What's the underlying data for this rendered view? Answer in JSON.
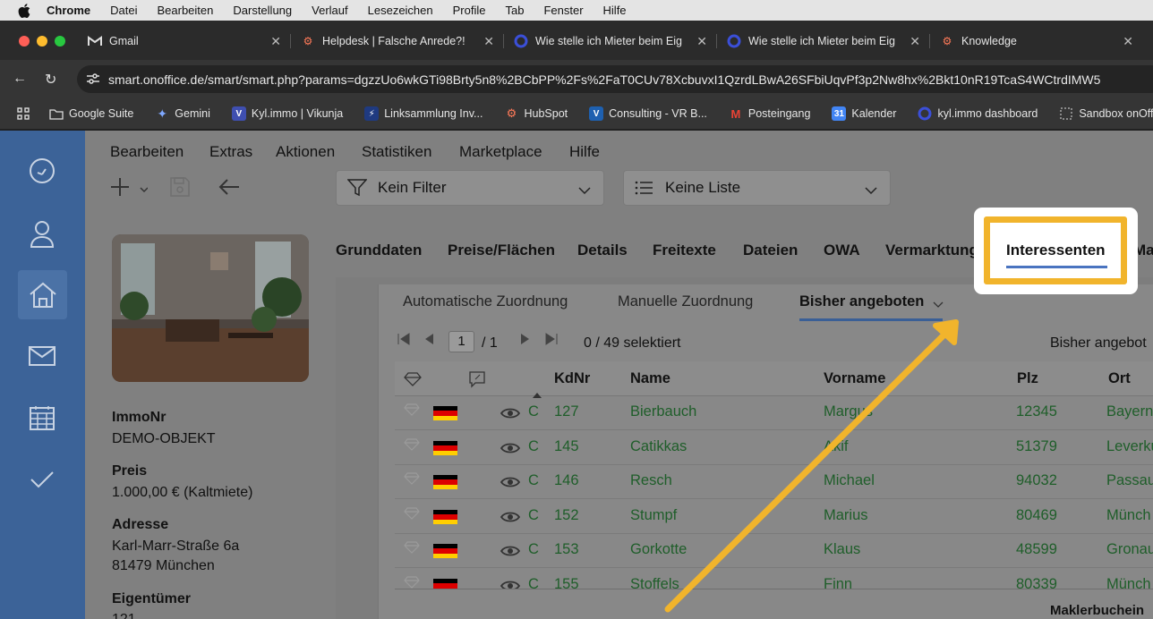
{
  "os_menu": {
    "app": "Chrome",
    "items": [
      "Datei",
      "Bearbeiten",
      "Darstellung",
      "Verlauf",
      "Lesezeichen",
      "Profile",
      "Tab",
      "Fenster",
      "Hilfe"
    ]
  },
  "tabs": [
    {
      "title": "Gmail",
      "icon": "gmail-icon"
    },
    {
      "title": "Helpdesk | Falsche Anrede?!",
      "icon": "hubspot-icon"
    },
    {
      "title": "Wie stelle ich Mieter beim Eig",
      "icon": "onoffice-icon"
    },
    {
      "title": "Wie stelle ich Mieter beim Eig",
      "icon": "onoffice-icon"
    },
    {
      "title": "Knowledge",
      "icon": "hubspot-icon"
    }
  ],
  "address": {
    "url": "smart.onoffice.de/smart/smart.php?params=dgzzUo6wkGTi98Brty5n8%2BCbPP%2Fs%2FaT0CUv78XcbuvxI1QzrdLBwA26SFbiUqvPf3p2Nw8hx%2Bkt10nR19TcaS4WCtrdIMW5"
  },
  "bookmarks": [
    {
      "label": "Google Suite",
      "icon": "folder-icon"
    },
    {
      "label": "Gemini",
      "icon": "gemini-icon"
    },
    {
      "label": "Kyl.immo | Vikunja",
      "icon": "vikunja-icon"
    },
    {
      "label": "Linksammlung Inv...",
      "icon": "link-icon"
    },
    {
      "label": "HubSpot",
      "icon": "hubspot-icon"
    },
    {
      "label": "Consulting - VR B...",
      "icon": "vr-icon"
    },
    {
      "label": "Posteingang",
      "icon": "gmail-icon"
    },
    {
      "label": "Kalender",
      "icon": "calendar-icon"
    },
    {
      "label": "kyl.immo dashboard",
      "icon": "onoffice-icon"
    },
    {
      "label": "Sandbox onOffice",
      "icon": "dashed-box-icon"
    }
  ],
  "app_menu": [
    "Bearbeiten",
    "Extras",
    "Aktionen",
    "Statistiken",
    "Marketplace",
    "Hilfe"
  ],
  "filters": {
    "filter_label": "Kein Filter",
    "list_label": "Keine Liste"
  },
  "estate": {
    "immonr_label": "ImmoNr",
    "immonr_value": "DEMO-OBJEKT",
    "preis_label": "Preis",
    "preis_value": "1.000,00 € (Kaltmiete)",
    "adresse_label": "Adresse",
    "adresse_line1": "Karl-Marr-Straße 6a",
    "adresse_line2": "81479 München",
    "eigentuemer_label": "Eigentümer",
    "eigentuemer_value": "121"
  },
  "main_tabs": [
    "Grunddaten",
    "Preise/Flächen",
    "Details",
    "Freitexte",
    "Dateien",
    "OWA",
    "Vermarktung",
    "Interessenten",
    "Ma"
  ],
  "active_main_tab": "Interessenten",
  "sub_tabs": [
    "Automatische Zuordnung",
    "Manuelle Zuordnung",
    "Bisher angeboten"
  ],
  "pager": {
    "page": "1",
    "total": "/ 1",
    "selected": "0 / 49 selektiert",
    "right_label": "Bisher angebot"
  },
  "table": {
    "headers": [
      "KdNr",
      "Name",
      "Vorname",
      "Plz",
      "Ort"
    ],
    "rows": [
      {
        "c": "C",
        "kdnr": "127",
        "name": "Bierbauch",
        "vorname": "Margus",
        "plz": "12345",
        "ort": "Bayern"
      },
      {
        "c": "C",
        "kdnr": "145",
        "name": "Catikkas",
        "vorname": "Akif",
        "plz": "51379",
        "ort": "Leverku"
      },
      {
        "c": "C",
        "kdnr": "146",
        "name": "Resch",
        "vorname": "Michael",
        "plz": "94032",
        "ort": "Passau"
      },
      {
        "c": "C",
        "kdnr": "152",
        "name": "Stumpf",
        "vorname": "Marius",
        "plz": "80469",
        "ort": "Münch"
      },
      {
        "c": "C",
        "kdnr": "153",
        "name": "Gorkotte",
        "vorname": "Klaus",
        "plz": "48599",
        "ort": "Gronau"
      },
      {
        "c": "C",
        "kdnr": "155",
        "name": "Stoffels",
        "vorname": "Finn",
        "plz": "80339",
        "ort": "Münch"
      }
    ]
  },
  "footer_label": "Maklerbuchein",
  "colors": {
    "highlight": "#f1b42c",
    "nav_bg": "#3c6398",
    "link_green": "#1f5e2a"
  }
}
